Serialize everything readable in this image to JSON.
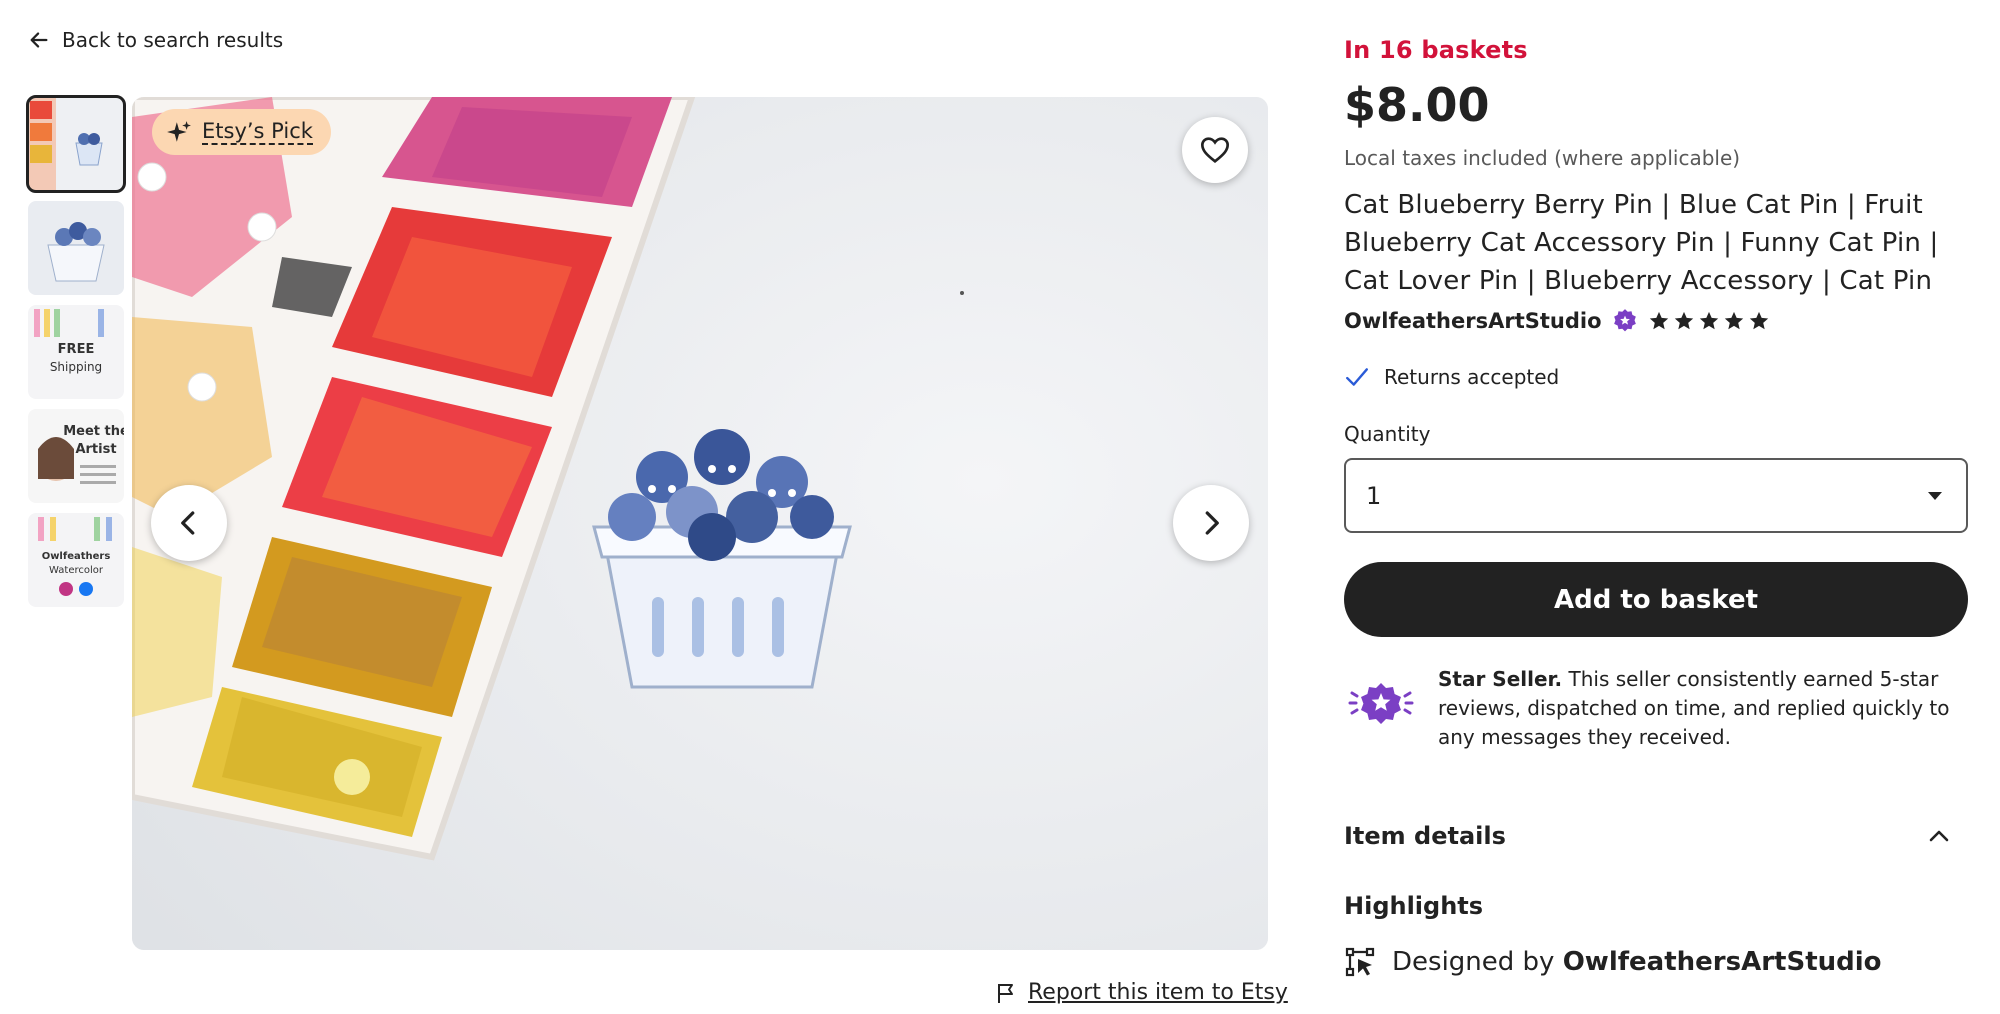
{
  "nav": {
    "back_label": "Back to search results"
  },
  "gallery": {
    "badge_label": "Etsy’s Pick",
    "thumbnails": [
      {
        "label": ""
      },
      {
        "label": ""
      },
      {
        "label": "FREE Shipping"
      },
      {
        "label": "Meet the Artist"
      },
      {
        "label": "Owlfeathers Watercolor"
      }
    ]
  },
  "report": {
    "label": "Report this item to Etsy"
  },
  "listing": {
    "baskets": "In 16 baskets",
    "price": "$8.00",
    "taxes": "Local taxes included (where applicable)",
    "title": "Cat Blueberry Berry Pin | Blue Cat Pin | Fruit Blueberry Cat Accessory Pin | Funny Cat Pin | Cat Lover Pin | Blueberry Accessory | Cat Pin",
    "seller": "OwlfeathersArtStudio",
    "rating": 5,
    "returns": "Returns accepted",
    "quantity_label": "Quantity",
    "quantity_value": "1",
    "add_to_basket": "Add to basket",
    "star_seller_title": "Star Seller.",
    "star_seller_text": "This seller consistently earned 5-star reviews, dispatched on time, and replied quickly to any messages they received.",
    "item_details": "Item details",
    "highlights": "Highlights",
    "designed_prefix": "Designed by",
    "designed_by": "OwlfeathersArtStudio"
  },
  "colors": {
    "baskets_red": "#d2123a",
    "button_dark": "#222222",
    "star_seller_purple": "#7b3fc4",
    "badge_peach": "#fcd7b2"
  }
}
